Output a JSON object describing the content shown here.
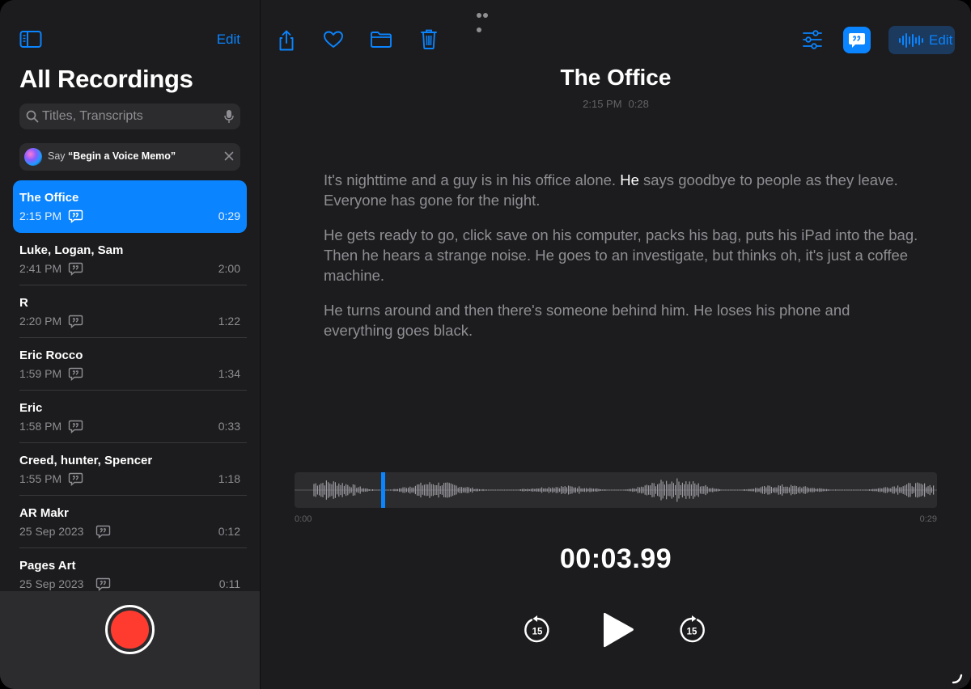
{
  "sidebar": {
    "edit_label": "Edit",
    "title": "All Recordings",
    "search_placeholder": "Titles, Transcripts",
    "siri_tip": {
      "prefix": "Say ",
      "phrase": "“Begin a Voice Memo”"
    },
    "recordings": [
      {
        "name": "The Office",
        "date": "2:15 PM",
        "duration": "0:29",
        "selected": true
      },
      {
        "name": "Luke, Logan, Sam",
        "date": "2:41 PM",
        "duration": "2:00"
      },
      {
        "name": "R",
        "date": "2:20 PM",
        "duration": "1:22"
      },
      {
        "name": "Eric Rocco",
        "date": "1:59 PM",
        "duration": "1:34"
      },
      {
        "name": "Eric",
        "date": "1:58 PM",
        "duration": "0:33"
      },
      {
        "name": "Creed, hunter, Spencer",
        "date": "1:55 PM",
        "duration": "1:18"
      },
      {
        "name": "AR Makr",
        "date": "25 Sep 2023",
        "duration": "0:12"
      },
      {
        "name": "Pages Art",
        "date": "25 Sep 2023",
        "duration": "0:11"
      }
    ]
  },
  "toolbar": {
    "icons": [
      "share-icon",
      "heart-icon",
      "folder-icon",
      "trash-icon",
      "sliders-icon",
      "transcript-icon",
      "waveform-icon"
    ],
    "edit_label": "Edit"
  },
  "main": {
    "title": "The Office",
    "time": "2:15 PM",
    "duration": "0:28",
    "transcript": {
      "p1_before": "It's nighttime and a guy is in his office alone. ",
      "p1_highlight": "He",
      "p1_after": " says goodbye to people as they leave. Everyone has gone for the night.",
      "p2": "He gets ready to go, click save on his computer, packs his bag, puts his iPad into the bag. Then he hears a strange noise. He goes to an investigate, but thinks oh, it's just a coffee machine.",
      "p3": "He turns around and then there's someone behind him. He loses his phone and everything goes black."
    },
    "waveform": {
      "start_label": "0:00",
      "end_label": "0:29",
      "playhead_fraction": 0.137
    },
    "elapsed": "00:03.99",
    "controls": {
      "skip_back": "15",
      "skip_forward": "15"
    }
  },
  "colors": {
    "accent": "#0a84ff",
    "record": "#ff3b30",
    "background": "#1c1c1e"
  }
}
